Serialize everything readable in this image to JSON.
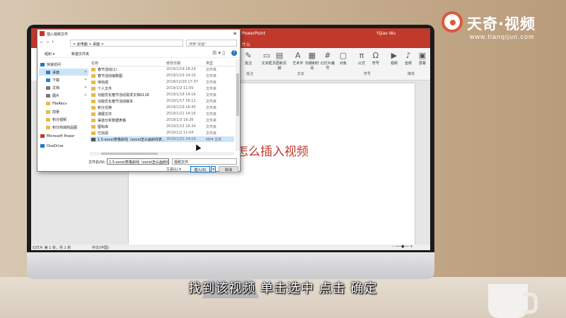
{
  "brand": {
    "name": "天奇·视频",
    "url": "www.tianqijun.com"
  },
  "subtitle": "找到该视频 单击选中 点击 确定",
  "ppt": {
    "app_name": "PowerPoint",
    "user": "Yijiao Wu",
    "menu_hint": "什么",
    "ribbon": [
      {
        "label": "批注",
        "icon": "comment-icon"
      },
      {
        "label": "文本框",
        "icon": "textbox-icon"
      },
      {
        "label": "页眉和页脚",
        "icon": "header-footer-icon"
      },
      {
        "label": "艺术字",
        "icon": "wordart-icon"
      },
      {
        "label": "日期和时间",
        "icon": "datetime-icon"
      },
      {
        "label": "幻灯片编号",
        "icon": "slide-number-icon"
      },
      {
        "label": "对象",
        "icon": "object-icon"
      },
      {
        "label": "公式",
        "icon": "formula-icon"
      },
      {
        "label": "符号",
        "icon": "symbol-icon"
      },
      {
        "label": "视频",
        "icon": "video-icon"
      },
      {
        "label": "音频",
        "icon": "audio-icon"
      },
      {
        "label": "屏幕",
        "icon": "screen-icon"
      }
    ],
    "groups": {
      "comments": "批注",
      "text": "文本",
      "symbols": "符号",
      "media": "媒体"
    },
    "slide_text": "怎么插入视频",
    "status_left": "幻灯片 第 1 张，共 1 张",
    "status_lang": "中文(中国)"
  },
  "dialog": {
    "title": "插入视频文件",
    "path": "> 此电脑 > 桌面 >",
    "search_placeholder": "搜索\"桌面\"",
    "organize": "组织 ▾",
    "new_folder": "新建文件夹",
    "nav_items": [
      {
        "label": "快速访问",
        "pin": false
      },
      {
        "label": "桌面",
        "pin": true
      },
      {
        "label": "下载",
        "pin": true
      },
      {
        "label": "文档",
        "pin": true
      },
      {
        "label": "图片",
        "pin": true
      },
      {
        "label": "FileRecv",
        "pin": false
      },
      {
        "label": "前景",
        "pin": false
      },
      {
        "label": "积分视频",
        "pin": false
      },
      {
        "label": "积分商城商品图",
        "pin": false
      },
      {
        "label": "Microsoft Power",
        "pin": false
      },
      {
        "label": "OneDrive",
        "pin": false
      }
    ],
    "columns": {
      "name": "名称",
      "date": "修改日期",
      "type": "类型"
    },
    "files": [
      {
        "name": "春节活动(1)",
        "date": "2019/1/19 18:29",
        "type": "文件夹"
      },
      {
        "name": "春节活动输致图",
        "date": "2019/1/19 14:16",
        "type": "文件夹"
      },
      {
        "name": "待完成",
        "date": "2018/12/29 17:37",
        "type": "文件夹"
      },
      {
        "name": "个人文件",
        "date": "2019/1/2 11:05",
        "type": "文件夹"
      },
      {
        "name": "功能优化春节活动需求文档0118",
        "date": "2019/1/18 14:16",
        "type": "文件夹"
      },
      {
        "name": "功能优化春节活动版本",
        "date": "2019/1/17 16:11",
        "type": "文件夹"
      },
      {
        "name": "积分兑换",
        "date": "2019/1/19 16:40",
        "type": "文件夹"
      },
      {
        "name": "课展文件",
        "date": "2019/1/21 14:16",
        "type": "文件夹"
      },
      {
        "name": "渠道分析数据表格",
        "date": "2019/1/3 16:26",
        "type": "文件夹"
      },
      {
        "name": "图标库",
        "date": "2019/1/15 19:34",
        "type": "文件夹"
      },
      {
        "name": "已完成",
        "date": "2019/1/2 11:04",
        "type": "文件夹"
      },
      {
        "name": "1.5-excel表格斜线（excel怎么画斜线表...",
        "date": "2019/1/21 14:16",
        "type": "MP4 文件"
      }
    ],
    "selected_index": 11,
    "filename_label": "文件名(N):",
    "filename_value": "1.5-excel表格斜线（excel怎么画斜线表头）",
    "filetype": "视频文件",
    "tools_label": "工具(L) ▾",
    "insert_label": "插入(S)",
    "cancel_label": "取消"
  }
}
